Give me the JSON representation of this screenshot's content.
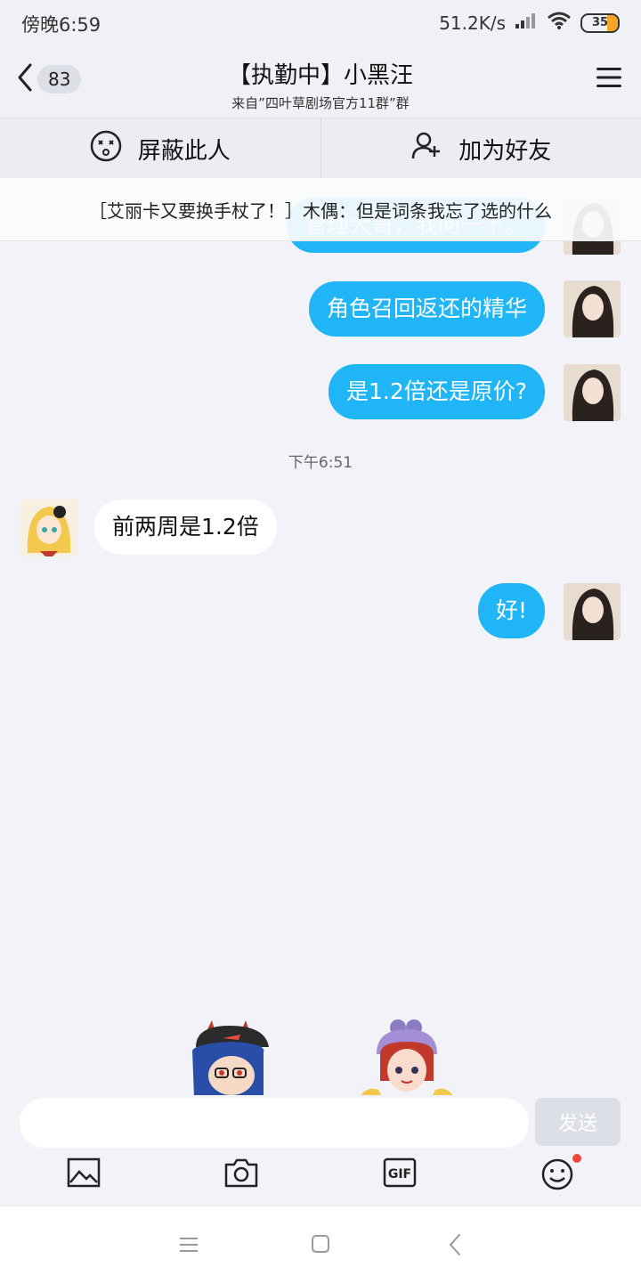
{
  "status_bar": {
    "time": "傍晚6:59",
    "network_speed": "51.2K/s",
    "battery": "35"
  },
  "header": {
    "back_count": "83",
    "title": "【执勤中】小黑汪",
    "subtitle": "来自”四叶草剧场官方11群”群"
  },
  "actions": {
    "block_label": "屏蔽此人",
    "add_friend_label": "加为好友"
  },
  "banner": {
    "text": "［艾丽卡又要换手杖了！］木偶：但是词条我忘了选的什么"
  },
  "messages": [
    {
      "from": "me",
      "text": "管理大哥，我问一下。"
    },
    {
      "from": "me",
      "text": "角色召回返还的精华"
    },
    {
      "from": "me",
      "text": "是1.2倍还是原价?"
    },
    {
      "type": "time",
      "text": "下午6:51"
    },
    {
      "from": "other",
      "text": "前两周是1.2倍"
    },
    {
      "from": "me",
      "text": "好!"
    }
  ],
  "input": {
    "placeholder": "",
    "send_label": "发送"
  },
  "tools": [
    "image-icon",
    "camera-icon",
    "gif-icon",
    "emoji-icon"
  ],
  "colors": {
    "my_bubble": "#1fb5f7",
    "other_bubble": "#ffffff",
    "background": "#f1f3f8",
    "notification_dot": "#f2463a"
  }
}
